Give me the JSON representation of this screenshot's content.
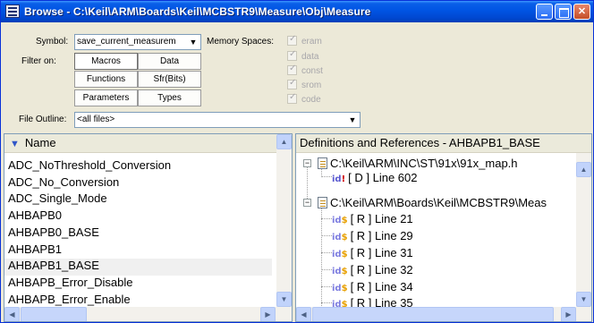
{
  "window": {
    "title": "Browse - C:\\Keil\\ARM\\Boards\\Keil\\MCBSTR9\\Measure\\Obj\\Measure",
    "min_glyph": "",
    "max_glyph": "",
    "close_glyph": "✕"
  },
  "controls": {
    "symbol_label": "Symbol:",
    "symbol_value": "save_current_measurem",
    "combo_arrow": "▼",
    "filter_label": "Filter on:",
    "filter_buttons": [
      "Macros",
      "Data",
      "Functions",
      "Sfr(Bits)",
      "Parameters",
      "Types"
    ],
    "memory_label": "Memory Spaces:",
    "memory_spaces": [
      "eram",
      "data",
      "const",
      "srom",
      "code"
    ],
    "file_outline_label": "File Outline:",
    "file_outline_value": "<all files>"
  },
  "left_panel": {
    "header_arrow": "▼",
    "header": "Name",
    "selected_index": 7,
    "items": [
      "ADC_NoThreshold_Conversion",
      "ADC_No_Conversion",
      "ADC_Single_Mode",
      "AHBAPB0",
      "AHBAPB0_BASE",
      "AHBAPB1",
      "AHBAPB1_BASE",
      "AHBAPB_Error_Disable",
      "AHBAPB_Error_Enable"
    ]
  },
  "right_panel": {
    "header": "Definitions and References - AHBAPB1_BASE",
    "tree": [
      {
        "kind": "file",
        "text": "C:\\Keil\\ARM\\INC\\ST\\91x\\91x_map.h"
      },
      {
        "kind": "def",
        "text": "[ D ] Line 602"
      },
      {
        "kind": "file",
        "text": "C:\\Keil\\ARM\\Boards\\Keil\\MCBSTR9\\Meas"
      },
      {
        "kind": "ref",
        "text": "[ R ] Line 21"
      },
      {
        "kind": "ref",
        "text": "[ R ] Line 29"
      },
      {
        "kind": "ref",
        "text": "[ R ] Line 31"
      },
      {
        "kind": "ref",
        "text": "[ R ] Line 32"
      },
      {
        "kind": "ref",
        "text": "[ R ] Line 34"
      },
      {
        "kind": "ref",
        "text": "[ R ] Line 35"
      }
    ]
  },
  "icons": {
    "expander_open": "−",
    "ref_icon_main": "id",
    "def_icon_mark": "!",
    "ref_icon_mark": "$",
    "scroll_up": "▲",
    "scroll_down": "▼",
    "scroll_left": "◀",
    "scroll_right": "▶"
  }
}
